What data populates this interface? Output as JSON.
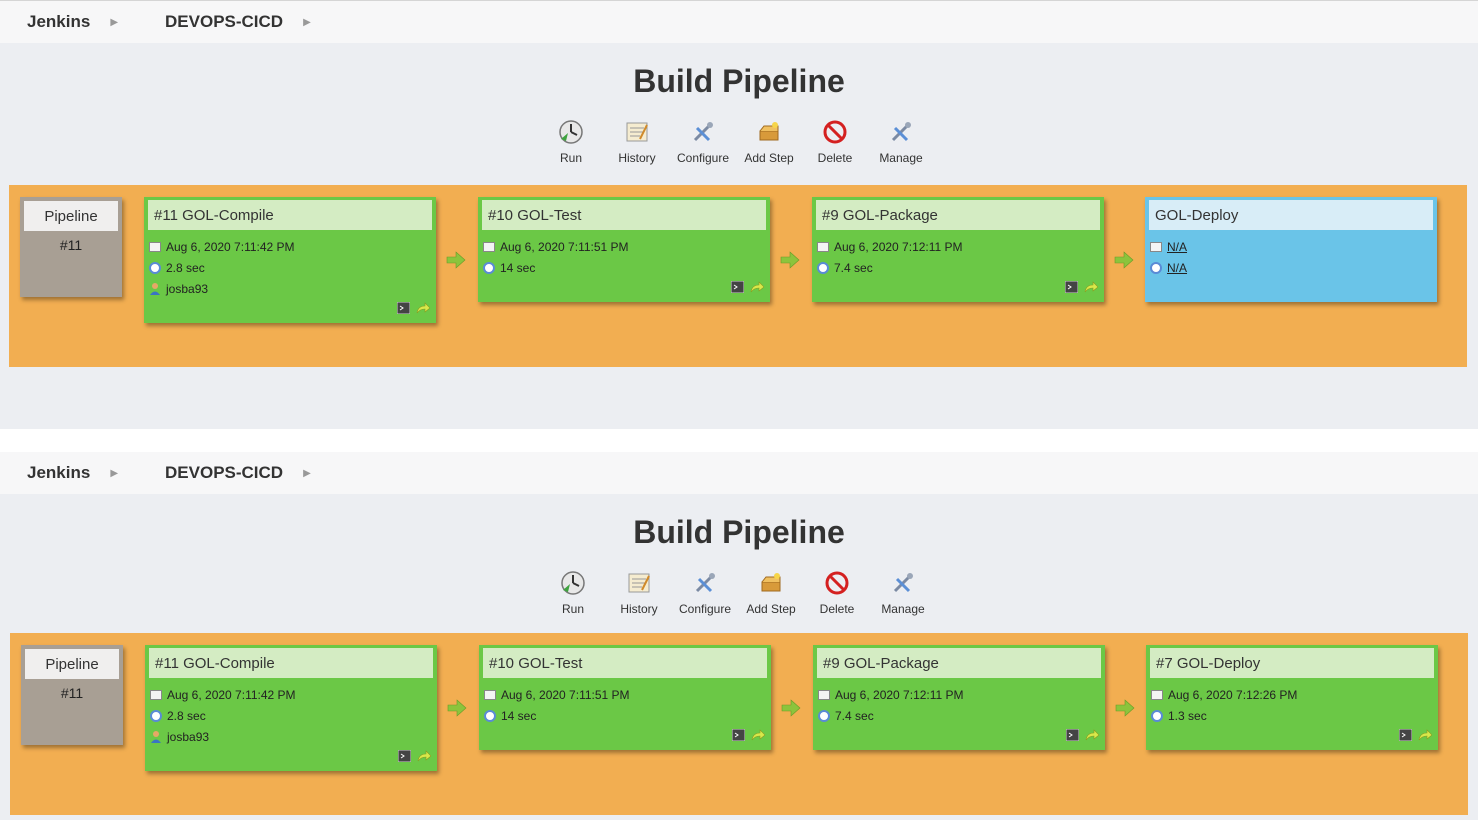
{
  "panels": [
    {
      "breadcrumb": [
        "Jenkins",
        "DEVOPS-CICD"
      ],
      "title": "Build Pipeline",
      "toolbar": [
        "Run",
        "History",
        "Configure",
        "Add Step",
        "Delete",
        "Manage"
      ],
      "pipeline": {
        "label": "Pipeline",
        "number": "#11"
      },
      "jobs": [
        {
          "name": "#11 GOL-Compile",
          "date": "Aug 6, 2020 7:11:42 PM",
          "duration": "2.8 sec",
          "user": "josba93",
          "status": "success"
        },
        {
          "name": "#10 GOL-Test",
          "date": "Aug 6, 2020 7:11:51 PM",
          "duration": "14 sec",
          "status": "success"
        },
        {
          "name": "#9 GOL-Package",
          "date": "Aug 6, 2020 7:12:11 PM",
          "duration": "7.4 sec",
          "status": "success"
        },
        {
          "name": "GOL-Deploy",
          "date": "N/A",
          "duration": "N/A",
          "status": "pending"
        }
      ]
    },
    {
      "breadcrumb": [
        "Jenkins",
        "DEVOPS-CICD"
      ],
      "title": "Build Pipeline",
      "toolbar": [
        "Run",
        "History",
        "Configure",
        "Add Step",
        "Delete",
        "Manage"
      ],
      "pipeline": {
        "label": "Pipeline",
        "number": "#11"
      },
      "jobs": [
        {
          "name": "#11 GOL-Compile",
          "date": "Aug 6, 2020 7:11:42 PM",
          "duration": "2.8 sec",
          "user": "josba93",
          "status": "success"
        },
        {
          "name": "#10 GOL-Test",
          "date": "Aug 6, 2020 7:11:51 PM",
          "duration": "14 sec",
          "status": "success"
        },
        {
          "name": "#9 GOL-Package",
          "date": "Aug 6, 2020 7:12:11 PM",
          "duration": "7.4 sec",
          "status": "success"
        },
        {
          "name": "#7 GOL-Deploy",
          "date": "Aug 6, 2020 7:12:26 PM",
          "duration": "1.3 sec",
          "status": "success"
        }
      ]
    }
  ],
  "colors": {
    "stage": "#f2ae51",
    "success": "#6bc846",
    "pending": "#6ac4e8",
    "pipeline": "#a89f94"
  },
  "icons": {
    "toolbar": [
      "run-icon",
      "history-icon",
      "configure-icon",
      "add-step-icon",
      "delete-icon",
      "manage-icon"
    ],
    "job_actions": [
      "console-icon",
      "rebuild-icon"
    ],
    "connector": "arrow-right-icon"
  }
}
